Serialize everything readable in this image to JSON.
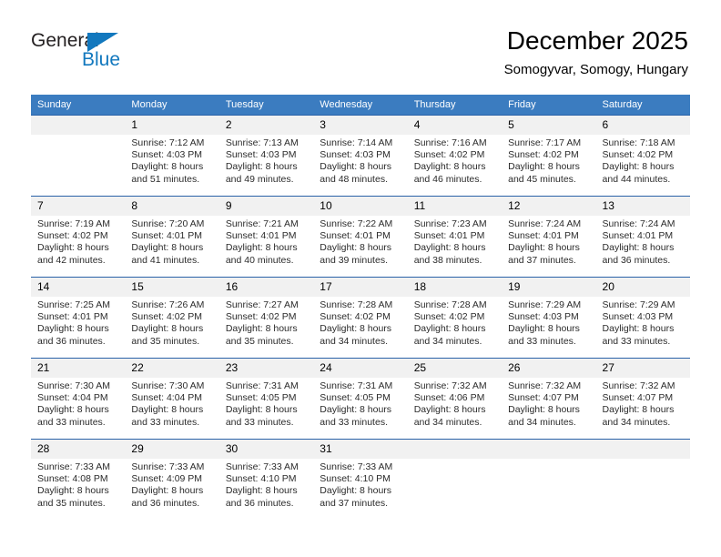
{
  "brand": {
    "name_top": "General",
    "name_bottom": "Blue",
    "color_blue": "#1278be",
    "color_dark": "#231f20"
  },
  "header": {
    "title": "December 2025",
    "subtitle": "Somogyvar, Somogy, Hungary",
    "header_bg": "#3b7cc0",
    "daynum_bg": "#f1f1f1",
    "week_divider": "#2a62a8"
  },
  "weekday_headers": [
    "Sunday",
    "Monday",
    "Tuesday",
    "Wednesday",
    "Thursday",
    "Friday",
    "Saturday"
  ],
  "weeks": [
    [
      {
        "day": "",
        "info": ""
      },
      {
        "day": "1",
        "info": "Sunrise: 7:12 AM\nSunset: 4:03 PM\nDaylight: 8 hours\nand 51 minutes."
      },
      {
        "day": "2",
        "info": "Sunrise: 7:13 AM\nSunset: 4:03 PM\nDaylight: 8 hours\nand 49 minutes."
      },
      {
        "day": "3",
        "info": "Sunrise: 7:14 AM\nSunset: 4:03 PM\nDaylight: 8 hours\nand 48 minutes."
      },
      {
        "day": "4",
        "info": "Sunrise: 7:16 AM\nSunset: 4:02 PM\nDaylight: 8 hours\nand 46 minutes."
      },
      {
        "day": "5",
        "info": "Sunrise: 7:17 AM\nSunset: 4:02 PM\nDaylight: 8 hours\nand 45 minutes."
      },
      {
        "day": "6",
        "info": "Sunrise: 7:18 AM\nSunset: 4:02 PM\nDaylight: 8 hours\nand 44 minutes."
      }
    ],
    [
      {
        "day": "7",
        "info": "Sunrise: 7:19 AM\nSunset: 4:02 PM\nDaylight: 8 hours\nand 42 minutes."
      },
      {
        "day": "8",
        "info": "Sunrise: 7:20 AM\nSunset: 4:01 PM\nDaylight: 8 hours\nand 41 minutes."
      },
      {
        "day": "9",
        "info": "Sunrise: 7:21 AM\nSunset: 4:01 PM\nDaylight: 8 hours\nand 40 minutes."
      },
      {
        "day": "10",
        "info": "Sunrise: 7:22 AM\nSunset: 4:01 PM\nDaylight: 8 hours\nand 39 minutes."
      },
      {
        "day": "11",
        "info": "Sunrise: 7:23 AM\nSunset: 4:01 PM\nDaylight: 8 hours\nand 38 minutes."
      },
      {
        "day": "12",
        "info": "Sunrise: 7:24 AM\nSunset: 4:01 PM\nDaylight: 8 hours\nand 37 minutes."
      },
      {
        "day": "13",
        "info": "Sunrise: 7:24 AM\nSunset: 4:01 PM\nDaylight: 8 hours\nand 36 minutes."
      }
    ],
    [
      {
        "day": "14",
        "info": "Sunrise: 7:25 AM\nSunset: 4:01 PM\nDaylight: 8 hours\nand 36 minutes."
      },
      {
        "day": "15",
        "info": "Sunrise: 7:26 AM\nSunset: 4:02 PM\nDaylight: 8 hours\nand 35 minutes."
      },
      {
        "day": "16",
        "info": "Sunrise: 7:27 AM\nSunset: 4:02 PM\nDaylight: 8 hours\nand 35 minutes."
      },
      {
        "day": "17",
        "info": "Sunrise: 7:28 AM\nSunset: 4:02 PM\nDaylight: 8 hours\nand 34 minutes."
      },
      {
        "day": "18",
        "info": "Sunrise: 7:28 AM\nSunset: 4:02 PM\nDaylight: 8 hours\nand 34 minutes."
      },
      {
        "day": "19",
        "info": "Sunrise: 7:29 AM\nSunset: 4:03 PM\nDaylight: 8 hours\nand 33 minutes."
      },
      {
        "day": "20",
        "info": "Sunrise: 7:29 AM\nSunset: 4:03 PM\nDaylight: 8 hours\nand 33 minutes."
      }
    ],
    [
      {
        "day": "21",
        "info": "Sunrise: 7:30 AM\nSunset: 4:04 PM\nDaylight: 8 hours\nand 33 minutes."
      },
      {
        "day": "22",
        "info": "Sunrise: 7:30 AM\nSunset: 4:04 PM\nDaylight: 8 hours\nand 33 minutes."
      },
      {
        "day": "23",
        "info": "Sunrise: 7:31 AM\nSunset: 4:05 PM\nDaylight: 8 hours\nand 33 minutes."
      },
      {
        "day": "24",
        "info": "Sunrise: 7:31 AM\nSunset: 4:05 PM\nDaylight: 8 hours\nand 33 minutes."
      },
      {
        "day": "25",
        "info": "Sunrise: 7:32 AM\nSunset: 4:06 PM\nDaylight: 8 hours\nand 34 minutes."
      },
      {
        "day": "26",
        "info": "Sunrise: 7:32 AM\nSunset: 4:07 PM\nDaylight: 8 hours\nand 34 minutes."
      },
      {
        "day": "27",
        "info": "Sunrise: 7:32 AM\nSunset: 4:07 PM\nDaylight: 8 hours\nand 34 minutes."
      }
    ],
    [
      {
        "day": "28",
        "info": "Sunrise: 7:33 AM\nSunset: 4:08 PM\nDaylight: 8 hours\nand 35 minutes."
      },
      {
        "day": "29",
        "info": "Sunrise: 7:33 AM\nSunset: 4:09 PM\nDaylight: 8 hours\nand 36 minutes."
      },
      {
        "day": "30",
        "info": "Sunrise: 7:33 AM\nSunset: 4:10 PM\nDaylight: 8 hours\nand 36 minutes."
      },
      {
        "day": "31",
        "info": "Sunrise: 7:33 AM\nSunset: 4:10 PM\nDaylight: 8 hours\nand 37 minutes."
      },
      {
        "day": "",
        "info": ""
      },
      {
        "day": "",
        "info": ""
      },
      {
        "day": "",
        "info": ""
      }
    ]
  ]
}
